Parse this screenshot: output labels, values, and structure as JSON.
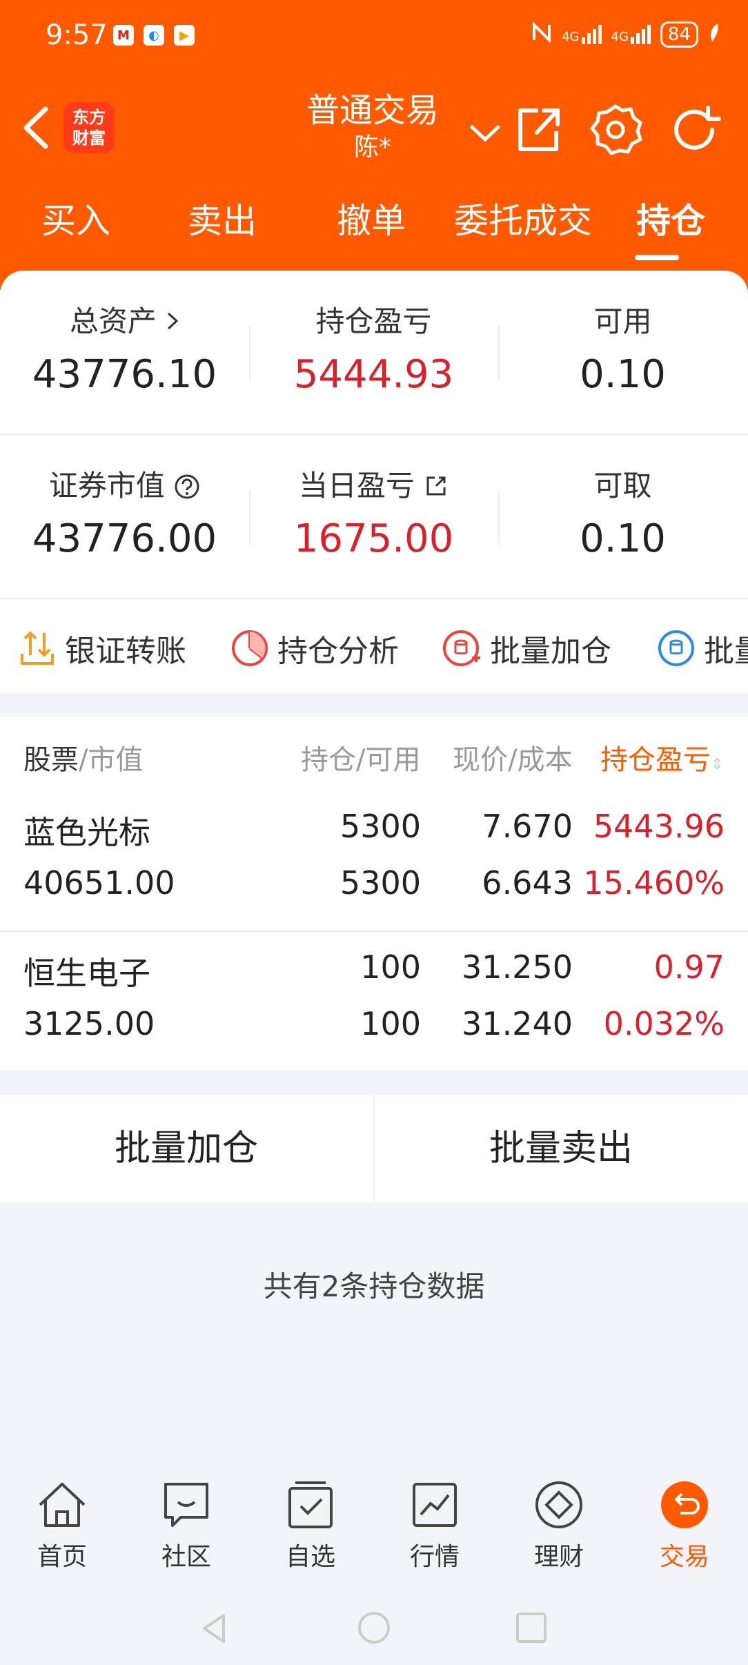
{
  "status_bar": {
    "time": "9:57",
    "battery": "84",
    "badges": [
      "M",
      "◐",
      "▶"
    ],
    "network1": "4G",
    "network2": "4G"
  },
  "header": {
    "logo_line1": "东方",
    "logo_line2": "财富",
    "title": "普通交易",
    "account": "陈*",
    "icons": [
      "back-icon",
      "chevron-down-icon",
      "share-icon",
      "gear-icon",
      "refresh-icon"
    ]
  },
  "tabs": [
    "买入",
    "卖出",
    "撤单",
    "委托成交",
    "持仓"
  ],
  "active_tab": "持仓",
  "summary": {
    "total_assets_label": "总资产",
    "total_assets": "43776.10",
    "position_pl_label": "持仓盈亏",
    "position_pl": "5444.93",
    "available_label": "可用",
    "available": "0.10",
    "market_value_label": "证券市值",
    "market_value": "43776.00",
    "daily_pl_label": "当日盈亏",
    "daily_pl": "1675.00",
    "withdrawable_label": "可取",
    "withdrawable": "0.10"
  },
  "tools": [
    "银证转账",
    "持仓分析",
    "批量加仓",
    "批量"
  ],
  "table": {
    "col1_a": "股票",
    "col1_b": "/市值",
    "col2": "持仓/可用",
    "col3": "现价/成本",
    "col4": "持仓盈亏",
    "rows": [
      {
        "name": "蓝色光标",
        "market_value": "40651.00",
        "position": "5300",
        "available": "5300",
        "price": "7.670",
        "cost": "6.643",
        "pl": "5443.96",
        "pl_pct": "15.460%"
      },
      {
        "name": "恒生电子",
        "market_value": "3125.00",
        "position": "100",
        "available": "100",
        "price": "31.250",
        "cost": "31.240",
        "pl": "0.97",
        "pl_pct": "0.032%"
      }
    ]
  },
  "actions": {
    "batch_add": "批量加仓",
    "batch_sell": "批量卖出"
  },
  "count_text": "共有2条持仓数据",
  "bottom_nav": [
    "首页",
    "社区",
    "自选",
    "行情",
    "理财",
    "交易"
  ],
  "active_bottom": "交易",
  "colors": {
    "brand": "#ff5a00",
    "loss_red": "#d9202b"
  }
}
